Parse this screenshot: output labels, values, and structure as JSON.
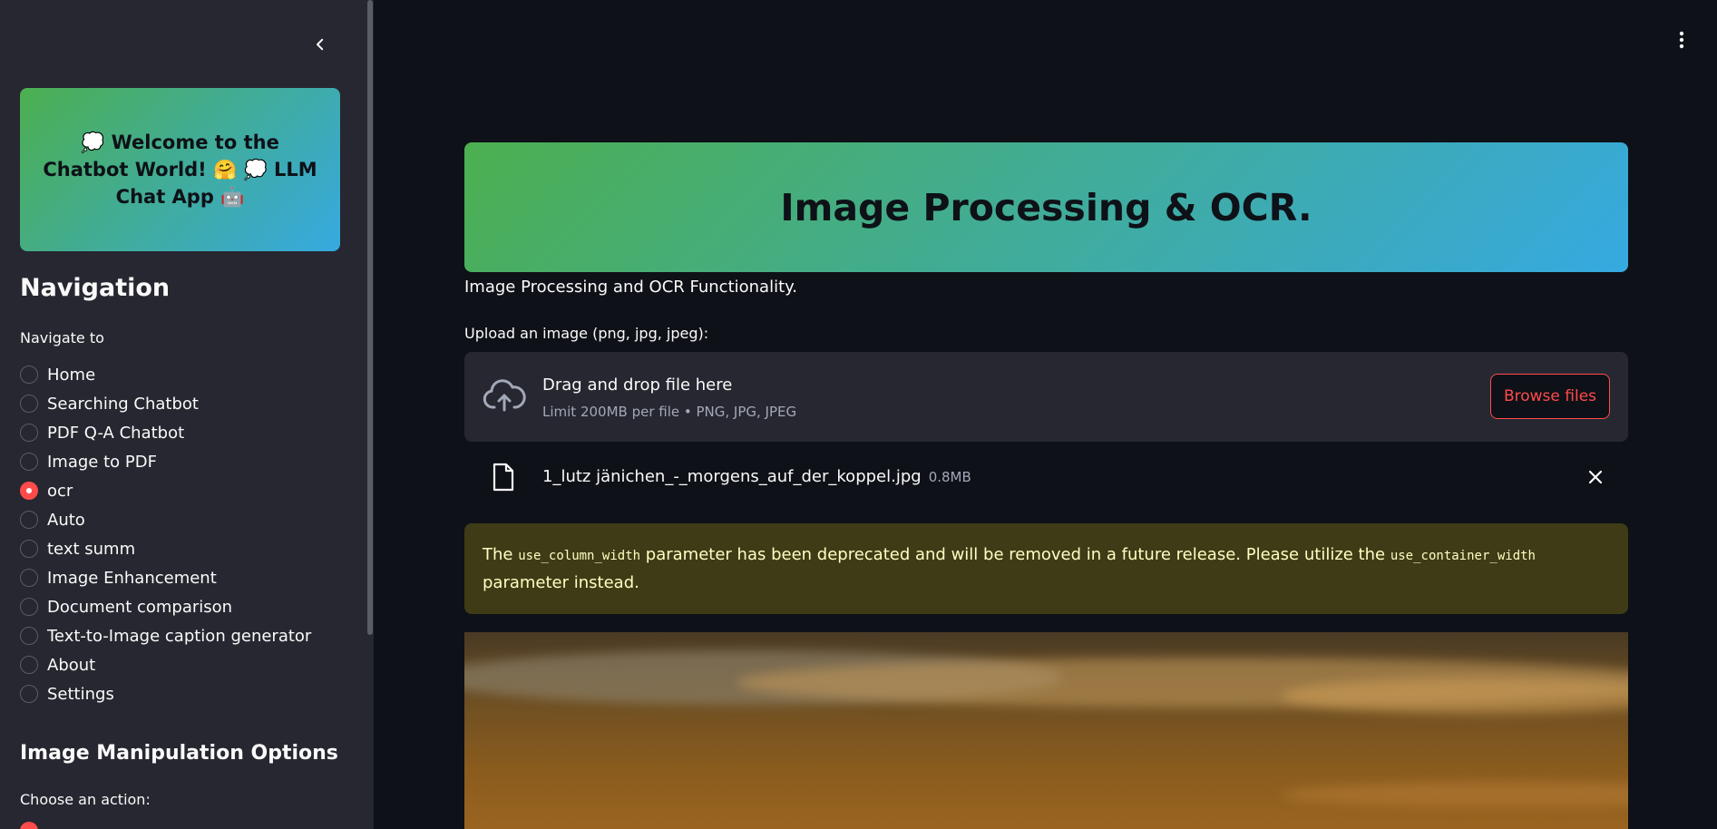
{
  "sidebar": {
    "welcome_title": "💭 Welcome to the Chatbot World! 🤗 💭 LLM Chat App 🤖",
    "navigation_heading": "Navigation",
    "navigate_label": "Navigate to",
    "nav_items": [
      {
        "label": "Home",
        "selected": false
      },
      {
        "label": "Searching Chatbot",
        "selected": false
      },
      {
        "label": "PDF Q-A Chatbot",
        "selected": false
      },
      {
        "label": "Image to PDF",
        "selected": false
      },
      {
        "label": "ocr",
        "selected": true
      },
      {
        "label": "Auto",
        "selected": false
      },
      {
        "label": "text summ",
        "selected": false
      },
      {
        "label": "Image Enhancement",
        "selected": false
      },
      {
        "label": "Document comparison",
        "selected": false
      },
      {
        "label": "Text-to-Image caption generator",
        "selected": false
      },
      {
        "label": "About",
        "selected": false
      },
      {
        "label": "Settings",
        "selected": false
      }
    ],
    "image_options_heading": "Image Manipulation Options",
    "choose_action_label": "Choose an action:"
  },
  "main": {
    "banner_title": "Image Processing & OCR.",
    "subtitle": "Image Processing and OCR Functionality.",
    "upload_label": "Upload an image (png, jpg, jpeg):",
    "dropzone": {
      "title": "Drag and drop file here",
      "limit": "Limit 200MB per file • PNG, JPG, JPEG",
      "browse_label": "Browse files"
    },
    "uploaded_file": {
      "name": "1_lutz jänichen_-_morgens_auf_der_koppel.jpg",
      "size": "0.8MB"
    },
    "warning": {
      "part1": "The ",
      "code1": "use_column_width",
      "part2": " parameter has been deprecated and will be removed in a future release. Please utilize the ",
      "code2": "use_container_width",
      "part3": " parameter instead."
    }
  },
  "colors": {
    "background": "#0e1117",
    "sidebar": "#262730",
    "accent": "#ff4b4b",
    "gradient_start": "#4caf50",
    "gradient_end": "#36a9e1",
    "warning_bg": "#3e3b16",
    "warning_text": "#ffffc2"
  },
  "icons": {
    "collapse": "chevron-left-icon",
    "menu": "kebab-menu-icon",
    "upload": "cloud-upload-icon",
    "file": "file-icon",
    "remove": "close-icon"
  }
}
